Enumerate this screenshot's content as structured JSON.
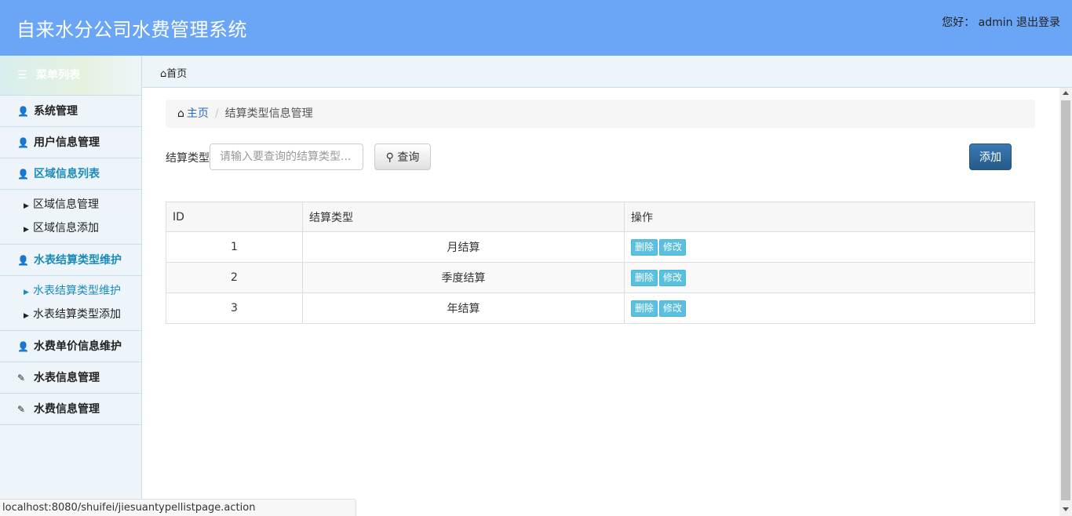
{
  "header": {
    "title": "自来水分公司水费管理系统",
    "greeting": "您好：",
    "username": "admin",
    "logout": "退出登录"
  },
  "sidebar": {
    "menu_title": "菜单列表",
    "items": [
      {
        "label": "系统管理"
      },
      {
        "label": "用户信息管理"
      },
      {
        "label": "区域信息列表",
        "subitems": [
          "区域信息管理",
          "区域信息添加"
        ]
      },
      {
        "label": "水表结算类型维护",
        "subitems": [
          "水表结算类型维护",
          "水表结算类型添加"
        ]
      },
      {
        "label": "水费单价信息维护"
      },
      {
        "label": "水表信息管理"
      },
      {
        "label": "水费信息管理"
      }
    ]
  },
  "topbar": {
    "home": "首页"
  },
  "breadcrumb": {
    "home": "主页",
    "separator": "/",
    "current": "结算类型信息管理"
  },
  "search": {
    "label": "结算类型",
    "placeholder": "请输入要查询的结算类型...",
    "button": "查询"
  },
  "add_button": "添加",
  "table": {
    "headers": [
      "ID",
      "结算类型",
      "操作"
    ],
    "rows": [
      {
        "id": "1",
        "type": "月结算"
      },
      {
        "id": "2",
        "type": "季度结算"
      },
      {
        "id": "3",
        "type": "年结算"
      }
    ],
    "delete_label": "删除",
    "edit_label": "修改"
  },
  "status_url": "localhost:8080/shuifei/jiesuantypellistpage.action"
}
